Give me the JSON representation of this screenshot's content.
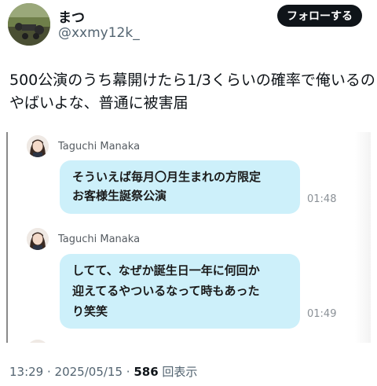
{
  "user": {
    "display_name": "まつ",
    "handle": "@xxmy12k_"
  },
  "follow_button": {
    "label": "フォローする"
  },
  "tweet": {
    "text_lines": [
      "500公演のうち幕開けたら1/3くらいの確率で俺いるの",
      "やばいよな、普通に被害届"
    ]
  },
  "embedded_chat": {
    "messages": [
      {
        "sender": "Taguchi Manaka",
        "lines": [
          "そういえば毎月〇月生まれの方限定",
          "お客様生誕祭公演"
        ],
        "time": "01:48"
      },
      {
        "sender": "Taguchi Manaka",
        "lines": [
          "してて、なぜか誕生日一年に何回か",
          "迎えてるやついるなって時もあった",
          "り笑笑"
        ],
        "time": "01:49"
      }
    ],
    "bubble_color": "#cdf0fa"
  },
  "meta": {
    "time": "13:29",
    "separator": " · ",
    "date": "2025/05/15",
    "separator2": " · ",
    "view_count": "586",
    "view_label": " 回表示"
  }
}
